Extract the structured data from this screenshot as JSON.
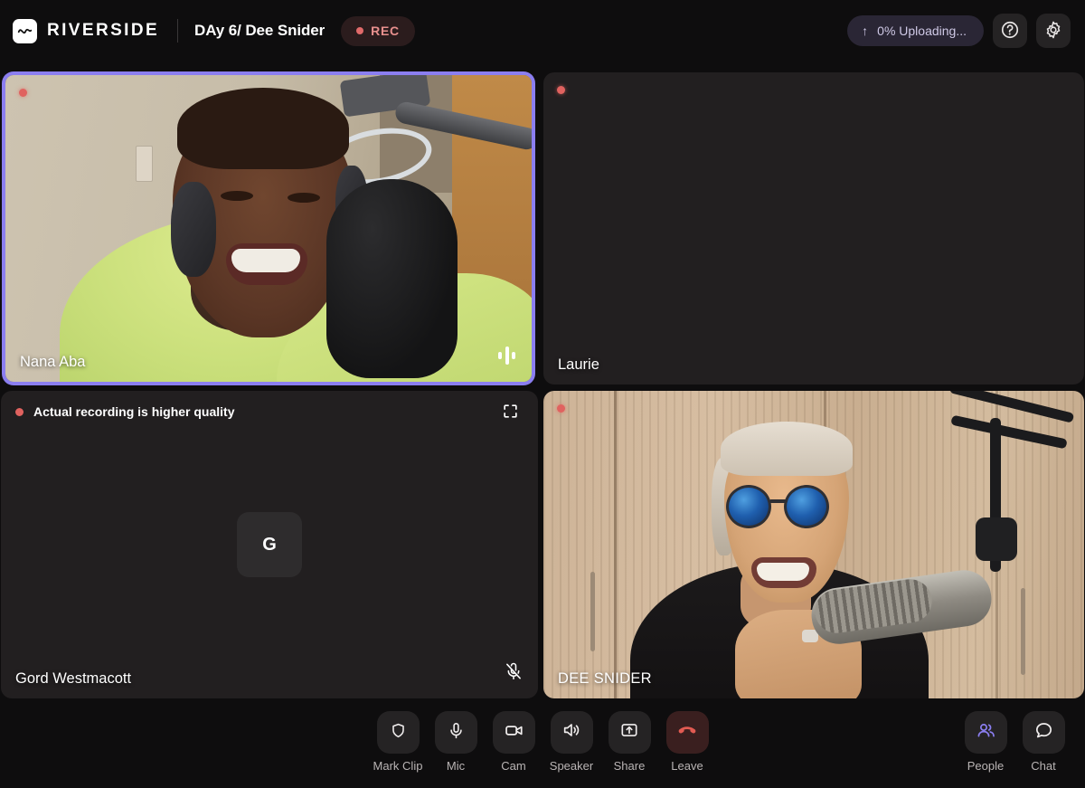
{
  "topbar": {
    "logo_icon": "riverside-wave-logo",
    "brand": "RIVERSIDE",
    "session_title": "DAy 6/ Dee Snider",
    "rec_label": "REC",
    "upload": {
      "arrow_icon": "upload-arrow-icon",
      "text": "0% Uploading...",
      "progress_percent": 0
    },
    "help_icon": "help-circle-icon",
    "settings_icon": "gear-icon"
  },
  "tiles": [
    {
      "id": "nana",
      "name": "Nana Aba",
      "recording": true,
      "active_speaker": true,
      "audio_meter_icon": "audio-level-icon",
      "muted": false,
      "has_video": true
    },
    {
      "id": "laurie",
      "name": "Laurie",
      "recording": true,
      "active_speaker": false,
      "muted": false,
      "has_video": false
    },
    {
      "id": "gord",
      "name": "Gord Westmacott",
      "recording": true,
      "active_speaker": false,
      "muted": true,
      "mute_icon": "mic-muted-icon",
      "expand_icon": "fullscreen-expand-icon",
      "quality_note": "Actual recording is higher quality",
      "avatar_initial": "G",
      "has_video": false
    },
    {
      "id": "dee",
      "name": "DEE SNIDER",
      "recording": true,
      "active_speaker": false,
      "muted": false,
      "has_video": true
    }
  ],
  "controls": [
    {
      "label": "Mark Clip",
      "icon": "shield-icon"
    },
    {
      "label": "Mic",
      "icon": "microphone-icon"
    },
    {
      "label": "Cam",
      "icon": "camera-icon"
    },
    {
      "label": "Speaker",
      "icon": "speaker-icon"
    },
    {
      "label": "Share",
      "icon": "share-screen-icon"
    },
    {
      "label": "Leave",
      "icon": "hangup-phone-icon"
    }
  ],
  "right_controls": [
    {
      "label": "People",
      "icon": "people-icon",
      "active": true
    },
    {
      "label": "Chat",
      "icon": "chat-bubble-icon",
      "active": false
    }
  ],
  "colors": {
    "background": "#0e0d0e",
    "tile_background": "#221f20",
    "accent_purple": "#8b7ef0",
    "rec_red": "#e0625f",
    "rec_badge_bg": "#2b1c1d",
    "rec_badge_text": "#e8908e",
    "upload_bg": "#2a2635",
    "upload_text": "#cfc9e6",
    "button_bg": "#252324",
    "leave_bg": "#3a1f1f",
    "leave_red": "#e25b52"
  }
}
